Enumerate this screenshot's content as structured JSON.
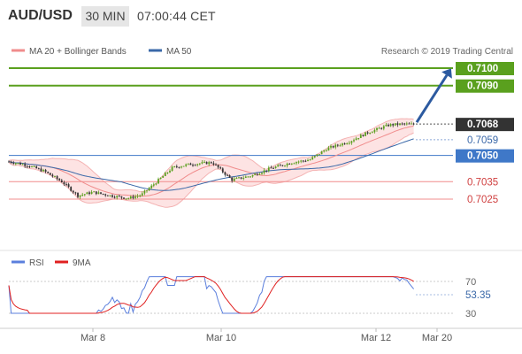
{
  "header": {
    "pair": "AUD/USD",
    "timeframe": "30 MIN",
    "time": "07:00:44 CET"
  },
  "legend": {
    "ma20_bollinger": "MA 20 + Bollinger Bands",
    "ma50": "MA 50",
    "credit": "Research © 2019 Trading Central"
  },
  "rsi_legend": {
    "rsi": "RSI",
    "ma9": "9MA"
  },
  "colors": {
    "target": "#5aa01e",
    "pivot": "#3f78c8",
    "support": "#f08c8c",
    "current": "#333333",
    "ma50": "#3a68a8",
    "bollinger_fill": "#fde3e3",
    "rsi_line": "#5b7fdd",
    "rsi_ma": "#e02020",
    "candle_up": "#5aa01e",
    "candle_down": "#333333",
    "arrow": "#2c5aa0"
  },
  "chart_data": [
    {
      "type": "candlestick",
      "title": "AUD/USD",
      "timeframe": "30 MIN",
      "x_labels": [
        "Mar 8",
        "Mar 10",
        "Mar 12",
        "Mar 20"
      ],
      "ylim": [
        7.01,
        7.11
      ],
      "levels": [
        {
          "label": "0.7100",
          "value": 7.1,
          "kind": "target"
        },
        {
          "label": "0.7090",
          "value": 7.09,
          "kind": "target"
        },
        {
          "label": "0.7068",
          "value": 7.068,
          "kind": "current"
        },
        {
          "label": "0.7059",
          "value": 7.059,
          "kind": "ma"
        },
        {
          "label": "0.7050",
          "value": 7.05,
          "kind": "pivot"
        },
        {
          "label": "0.7035",
          "value": 7.035,
          "kind": "support"
        },
        {
          "label": "0.7025",
          "value": 7.025,
          "kind": "support"
        }
      ],
      "series": [
        {
          "name": "MA 20 + Bollinger Bands"
        },
        {
          "name": "MA 50"
        }
      ],
      "forecast": {
        "from": 7.068,
        "to": 7.1
      }
    },
    {
      "type": "line",
      "title": "RSI",
      "ylim": [
        20,
        80
      ],
      "gridlines": [
        70,
        30
      ],
      "tick_labels": [
        "70",
        "30"
      ],
      "current_value": "53.35",
      "series": [
        {
          "name": "RSI"
        },
        {
          "name": "9MA"
        }
      ]
    }
  ]
}
